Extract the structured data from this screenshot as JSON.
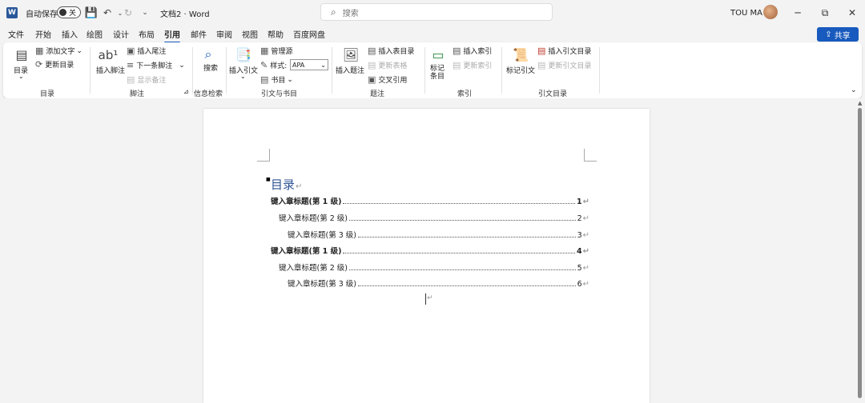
{
  "titlebar": {
    "app_logo": "W",
    "autosave_label": "自动保存",
    "autosave_state": "关",
    "doc_title": "文档2 · Word",
    "search_placeholder": "搜索",
    "user_name": "TOU MA",
    "minimize": "─",
    "maximize": "⧉",
    "close": "✕"
  },
  "tabs": [
    {
      "label": "文件"
    },
    {
      "label": "开始"
    },
    {
      "label": "插入"
    },
    {
      "label": "绘图"
    },
    {
      "label": "设计"
    },
    {
      "label": "布局"
    },
    {
      "label": "引用",
      "active": true
    },
    {
      "label": "邮件"
    },
    {
      "label": "审阅"
    },
    {
      "label": "视图"
    },
    {
      "label": "帮助"
    },
    {
      "label": "百度网盘"
    }
  ],
  "share_label": "共享",
  "ribbon": {
    "toc": {
      "button": "目录",
      "add_text": "添加文字",
      "update_toc": "更新目录",
      "group": "目录"
    },
    "footnotes": {
      "insert_footnote": "插入脚注",
      "insert_endnote": "插入尾注",
      "next_footnote": "下一条脚注",
      "show_notes": "显示备注",
      "group": "脚注"
    },
    "research": {
      "search": "搜索",
      "group": "信息检索"
    },
    "citations": {
      "insert_citation": "插入引文",
      "manage_sources": "管理源",
      "style_label": "样式:",
      "style_value": "APA",
      "bibliography": "书目",
      "group": "引文与书目"
    },
    "captions": {
      "insert_caption": "插入题注",
      "insert_table_of_figures": "插入表目录",
      "update_table": "更新表格",
      "cross_reference": "交叉引用",
      "group": "题注"
    },
    "index": {
      "mark_entry": "标记条目",
      "insert_index": "插入索引",
      "update_index": "更新索引",
      "group": "索引"
    },
    "toa": {
      "mark_citation": "标记引文",
      "insert_toa": "插入引文目录",
      "update_toa": "更新引文目录",
      "group": "引文目录"
    }
  },
  "document": {
    "toc_title": "目录",
    "paragraph_mark": "↵",
    "entries": [
      {
        "text": "键入章标题(第 1 级)",
        "page": "1",
        "level": 1
      },
      {
        "text": "键入章标题(第 2 级)",
        "page": "2",
        "level": 2
      },
      {
        "text": "键入章标题(第 3 级)",
        "page": "3",
        "level": 3
      },
      {
        "text": "键入章标题(第 1 级)",
        "page": "4",
        "level": 1
      },
      {
        "text": "键入章标题(第 2 级)",
        "page": "5",
        "level": 2
      },
      {
        "text": "键入章标题(第 3 级)",
        "page": "6",
        "level": 3
      }
    ]
  },
  "colors": {
    "accent": "#185abd",
    "heading": "#2f5496",
    "save_icon": "#7a3db8"
  }
}
